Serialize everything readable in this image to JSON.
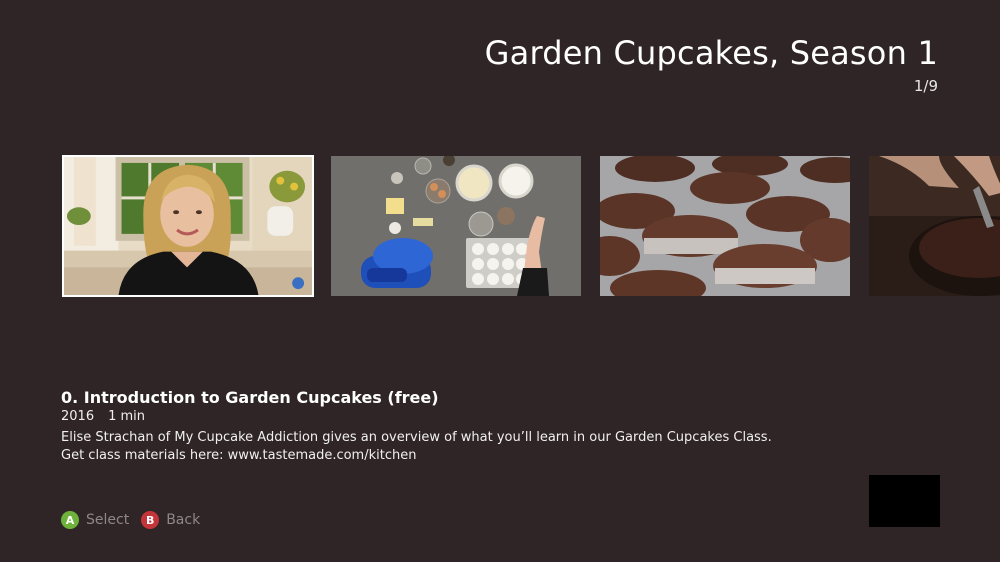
{
  "header": {
    "title": "Garden Cupcakes, Season 1",
    "counter": "1/9"
  },
  "carousel": {
    "items": [
      {
        "name": "episode-thumbnail-intro",
        "selected": true
      },
      {
        "name": "episode-thumbnail-ingredients",
        "selected": false
      },
      {
        "name": "episode-thumbnail-baked-cupcakes",
        "selected": false
      },
      {
        "name": "episode-thumbnail-chocolate-bowl",
        "selected": false
      }
    ]
  },
  "episode": {
    "title": "0. Introduction to Garden Cupcakes (free)",
    "year": "2016",
    "duration": "1 min",
    "description_line1": "Elise Strachan of My Cupcake Addiction gives an overview of what you’ll learn in our Garden Cupcakes Class.",
    "description_line2": "Get class materials here: www.tastemade.com/kitchen"
  },
  "hints": {
    "a_glyph": "A",
    "a_label": "Select",
    "b_glyph": "B",
    "b_label": "Back"
  },
  "colors": {
    "background": "#2f2526",
    "button_a": "#6fb23b",
    "button_b": "#c4353a",
    "hint_text": "#8e8788"
  }
}
